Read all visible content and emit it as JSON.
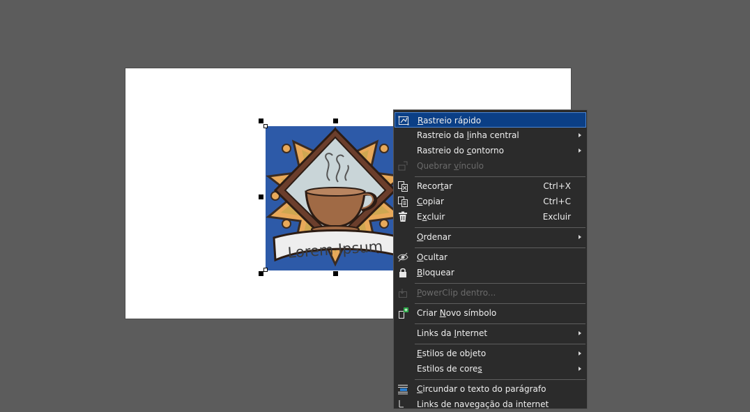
{
  "logo": {
    "text": "Lorem Ipsum"
  },
  "menu": {
    "items": [
      {
        "id": "rastreio-rapido",
        "pre": "",
        "u": "R",
        "post": "astreio rápido",
        "shortcut": "",
        "submenu": false,
        "disabled": false,
        "highlight": true
      },
      {
        "id": "rastreio-linha-central",
        "pre": "Rastreio da ",
        "u": "l",
        "post": "inha central",
        "shortcut": "",
        "submenu": true,
        "disabled": false
      },
      {
        "id": "rastreio-contorno",
        "pre": "Rastreio do ",
        "u": "c",
        "post": "ontorno",
        "shortcut": "",
        "submenu": true,
        "disabled": false
      },
      {
        "id": "quebrar-vinculo",
        "pre": "Quebrar ",
        "u": "v",
        "post": "ínculo",
        "shortcut": "",
        "submenu": false,
        "disabled": true
      },
      {
        "id": "recortar",
        "pre": "Recor",
        "u": "t",
        "post": "ar",
        "shortcut": "Ctrl+X",
        "submenu": false,
        "disabled": false
      },
      {
        "id": "copiar",
        "pre": "",
        "u": "C",
        "post": "opiar",
        "shortcut": "Ctrl+C",
        "submenu": false,
        "disabled": false
      },
      {
        "id": "excluir",
        "pre": "E",
        "u": "x",
        "post": "cluir",
        "shortcut": "Excluir",
        "submenu": false,
        "disabled": false
      },
      {
        "id": "ordenar",
        "pre": "",
        "u": "O",
        "post": "rdenar",
        "shortcut": "",
        "submenu": true,
        "disabled": false
      },
      {
        "id": "ocultar",
        "pre": "",
        "u": "O",
        "post": "cultar",
        "shortcut": "",
        "submenu": false,
        "disabled": false
      },
      {
        "id": "bloquear",
        "pre": "",
        "u": "B",
        "post": "loquear",
        "shortcut": "",
        "submenu": false,
        "disabled": false
      },
      {
        "id": "powerclip-dentro",
        "pre": "",
        "u": "P",
        "post": "owerClip dentro...",
        "shortcut": "",
        "submenu": false,
        "disabled": true
      },
      {
        "id": "criar-novo-simbolo",
        "pre": "Criar ",
        "u": "N",
        "post": "ovo símbolo",
        "shortcut": "",
        "submenu": false,
        "disabled": false
      },
      {
        "id": "links-internet",
        "pre": "Links da ",
        "u": "I",
        "post": "nternet",
        "shortcut": "",
        "submenu": true,
        "disabled": false
      },
      {
        "id": "estilos-objeto",
        "pre": "",
        "u": "E",
        "post": "stilos de objeto",
        "shortcut": "",
        "submenu": true,
        "disabled": false
      },
      {
        "id": "estilos-cores",
        "pre": "Estilos de core",
        "u": "s",
        "post": "",
        "shortcut": "",
        "submenu": true,
        "disabled": false
      },
      {
        "id": "circundar-texto",
        "pre": "",
        "u": "C",
        "post": "ircundar o texto do parágrafo",
        "shortcut": "",
        "submenu": false,
        "disabled": false
      },
      {
        "id": "links-cut-off",
        "pre": "Links de navegação da internet",
        "u": "",
        "post": "",
        "shortcut": "",
        "submenu": false,
        "disabled": false
      }
    ]
  }
}
